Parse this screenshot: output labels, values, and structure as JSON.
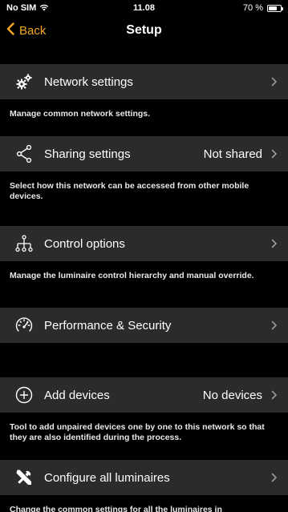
{
  "status_bar": {
    "carrier": "No SIM",
    "time": "11.08",
    "battery_text": "70 %",
    "battery_level": 0.7
  },
  "nav": {
    "back_label": "Back",
    "title": "Setup"
  },
  "rows": [
    {
      "label": "Network settings",
      "value": "",
      "icon": "gears-icon",
      "description": "Manage common network settings."
    },
    {
      "label": "Sharing settings",
      "value": "Not shared",
      "icon": "share-icon",
      "description": "Select how this network can be accessed from other mobile devices."
    },
    {
      "label": "Control options",
      "value": "",
      "icon": "hierarchy-icon",
      "description": "Manage the luminaire control hierarchy and manual override."
    },
    {
      "label": "Performance & Security",
      "value": "",
      "icon": "gauge-icon",
      "description": ""
    },
    {
      "label": "Add devices",
      "value": "No devices",
      "icon": "plus-circle-icon",
      "description": "Tool to add unpaired devices one by one to this network so that they are also identified during the process."
    },
    {
      "label": "Configure all luminaires",
      "value": "",
      "icon": "tools-icon",
      "description": "Change the common settings for all the luminaires in"
    }
  ],
  "colors": {
    "accent": "#f5a623",
    "row_bg": "#2b2b2d",
    "page_bg": "#000000"
  }
}
